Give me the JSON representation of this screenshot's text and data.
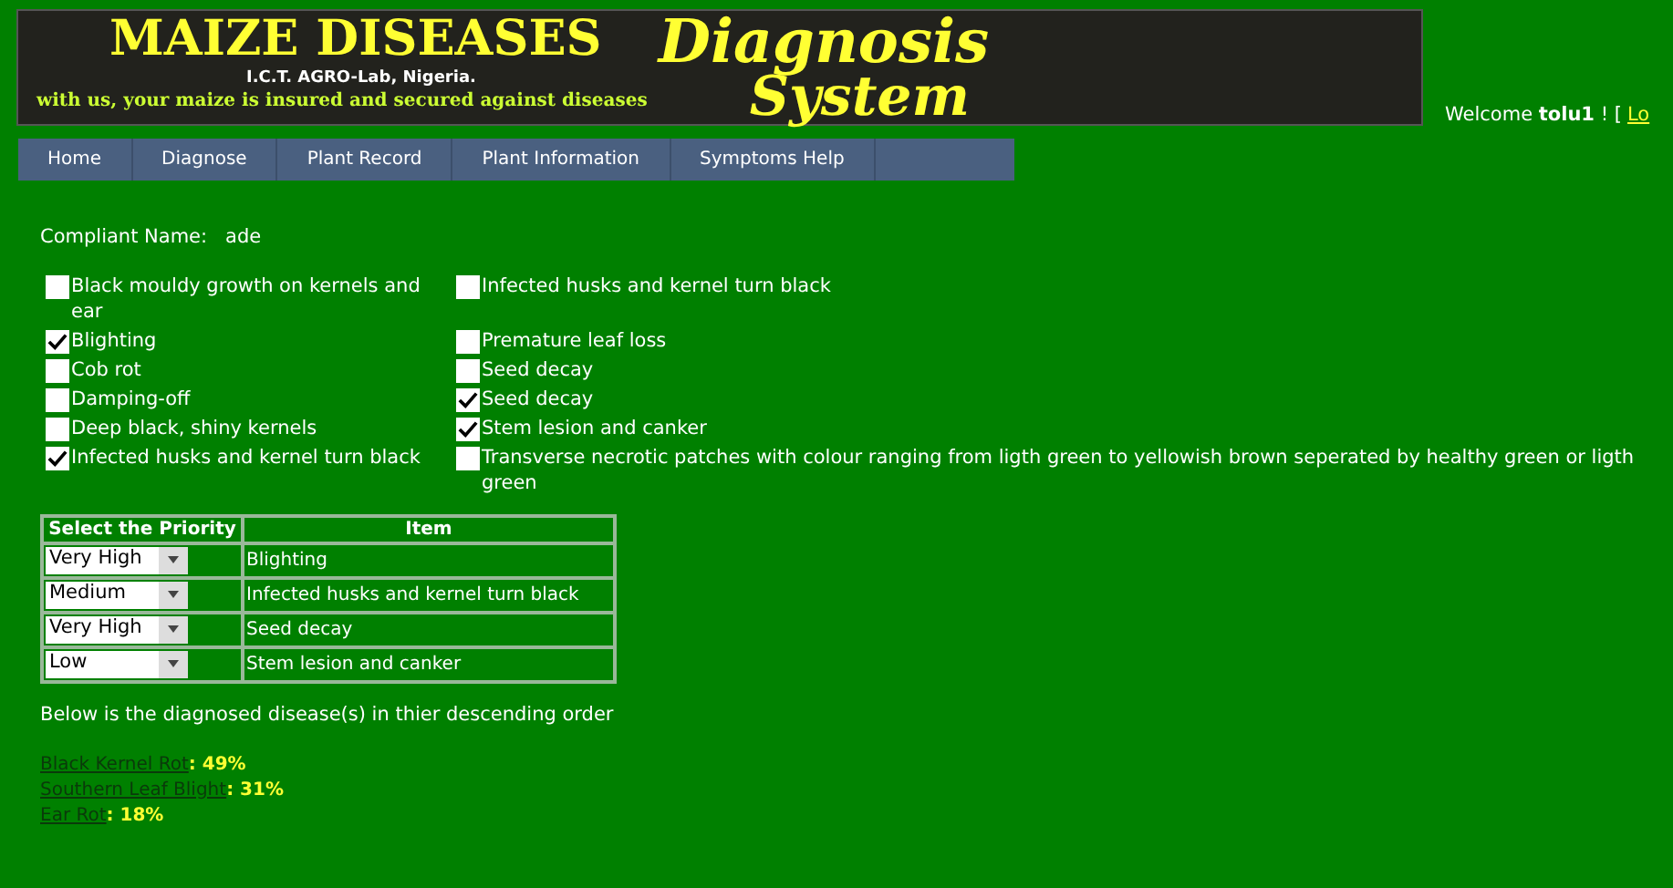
{
  "banner": {
    "title": "MAIZE DISEASES",
    "script_line_1": "Diagnosis",
    "script_line_2": "System",
    "subtitle": "I.C.T. AGRO-Lab, Nigeria.",
    "tagline": "with us, your maize is insured and secured against diseases"
  },
  "welcome": {
    "prefix": "Welcome",
    "user": "tolu1",
    "suffix": "! [",
    "link": "Lo"
  },
  "nav": [
    "Home",
    "Diagnose",
    "Plant Record",
    "Plant Information",
    "Symptoms Help"
  ],
  "complainant": {
    "label": "Compliant Name:",
    "value": "ade"
  },
  "symptoms": [
    {
      "label": "Black mouldy growth on kernels and ear",
      "checked": false
    },
    {
      "label": "Infected husks and kernel turn black",
      "checked": false
    },
    {
      "label": "Blighting",
      "checked": true
    },
    {
      "label": "Premature leaf loss",
      "checked": false
    },
    {
      "label": "Cob rot",
      "checked": false
    },
    {
      "label": "Seed decay",
      "checked": false
    },
    {
      "label": "Damping-off",
      "checked": false
    },
    {
      "label": "Seed decay",
      "checked": true
    },
    {
      "label": "Deep black, shiny kernels",
      "checked": false
    },
    {
      "label": "Stem lesion and canker",
      "checked": true
    },
    {
      "label": "Infected husks and kernel turn black",
      "checked": true
    },
    {
      "label": "Transverse necrotic patches with colour ranging from ligth green to yellowish brown seperated by healthy green or ligth green",
      "checked": false
    }
  ],
  "priority_table": {
    "columns": [
      "Select the Priority",
      "Item"
    ],
    "rows": [
      {
        "priority": "Very High",
        "item": "Blighting"
      },
      {
        "priority": "Medium",
        "item": "Infected husks and kernel turn black"
      },
      {
        "priority": "Very High",
        "item": "Seed decay"
      },
      {
        "priority": "Low",
        "item": "Stem lesion and canker"
      }
    ]
  },
  "results_intro": "Below is the diagnosed disease(s) in thier descending order",
  "results": [
    {
      "disease": "Black Kernel Rot",
      "percent": ": 49%"
    },
    {
      "disease": "Southern Leaf Blight",
      "percent": ": 31%"
    },
    {
      "disease": "Ear Rot",
      "percent": ": 18%"
    }
  ]
}
